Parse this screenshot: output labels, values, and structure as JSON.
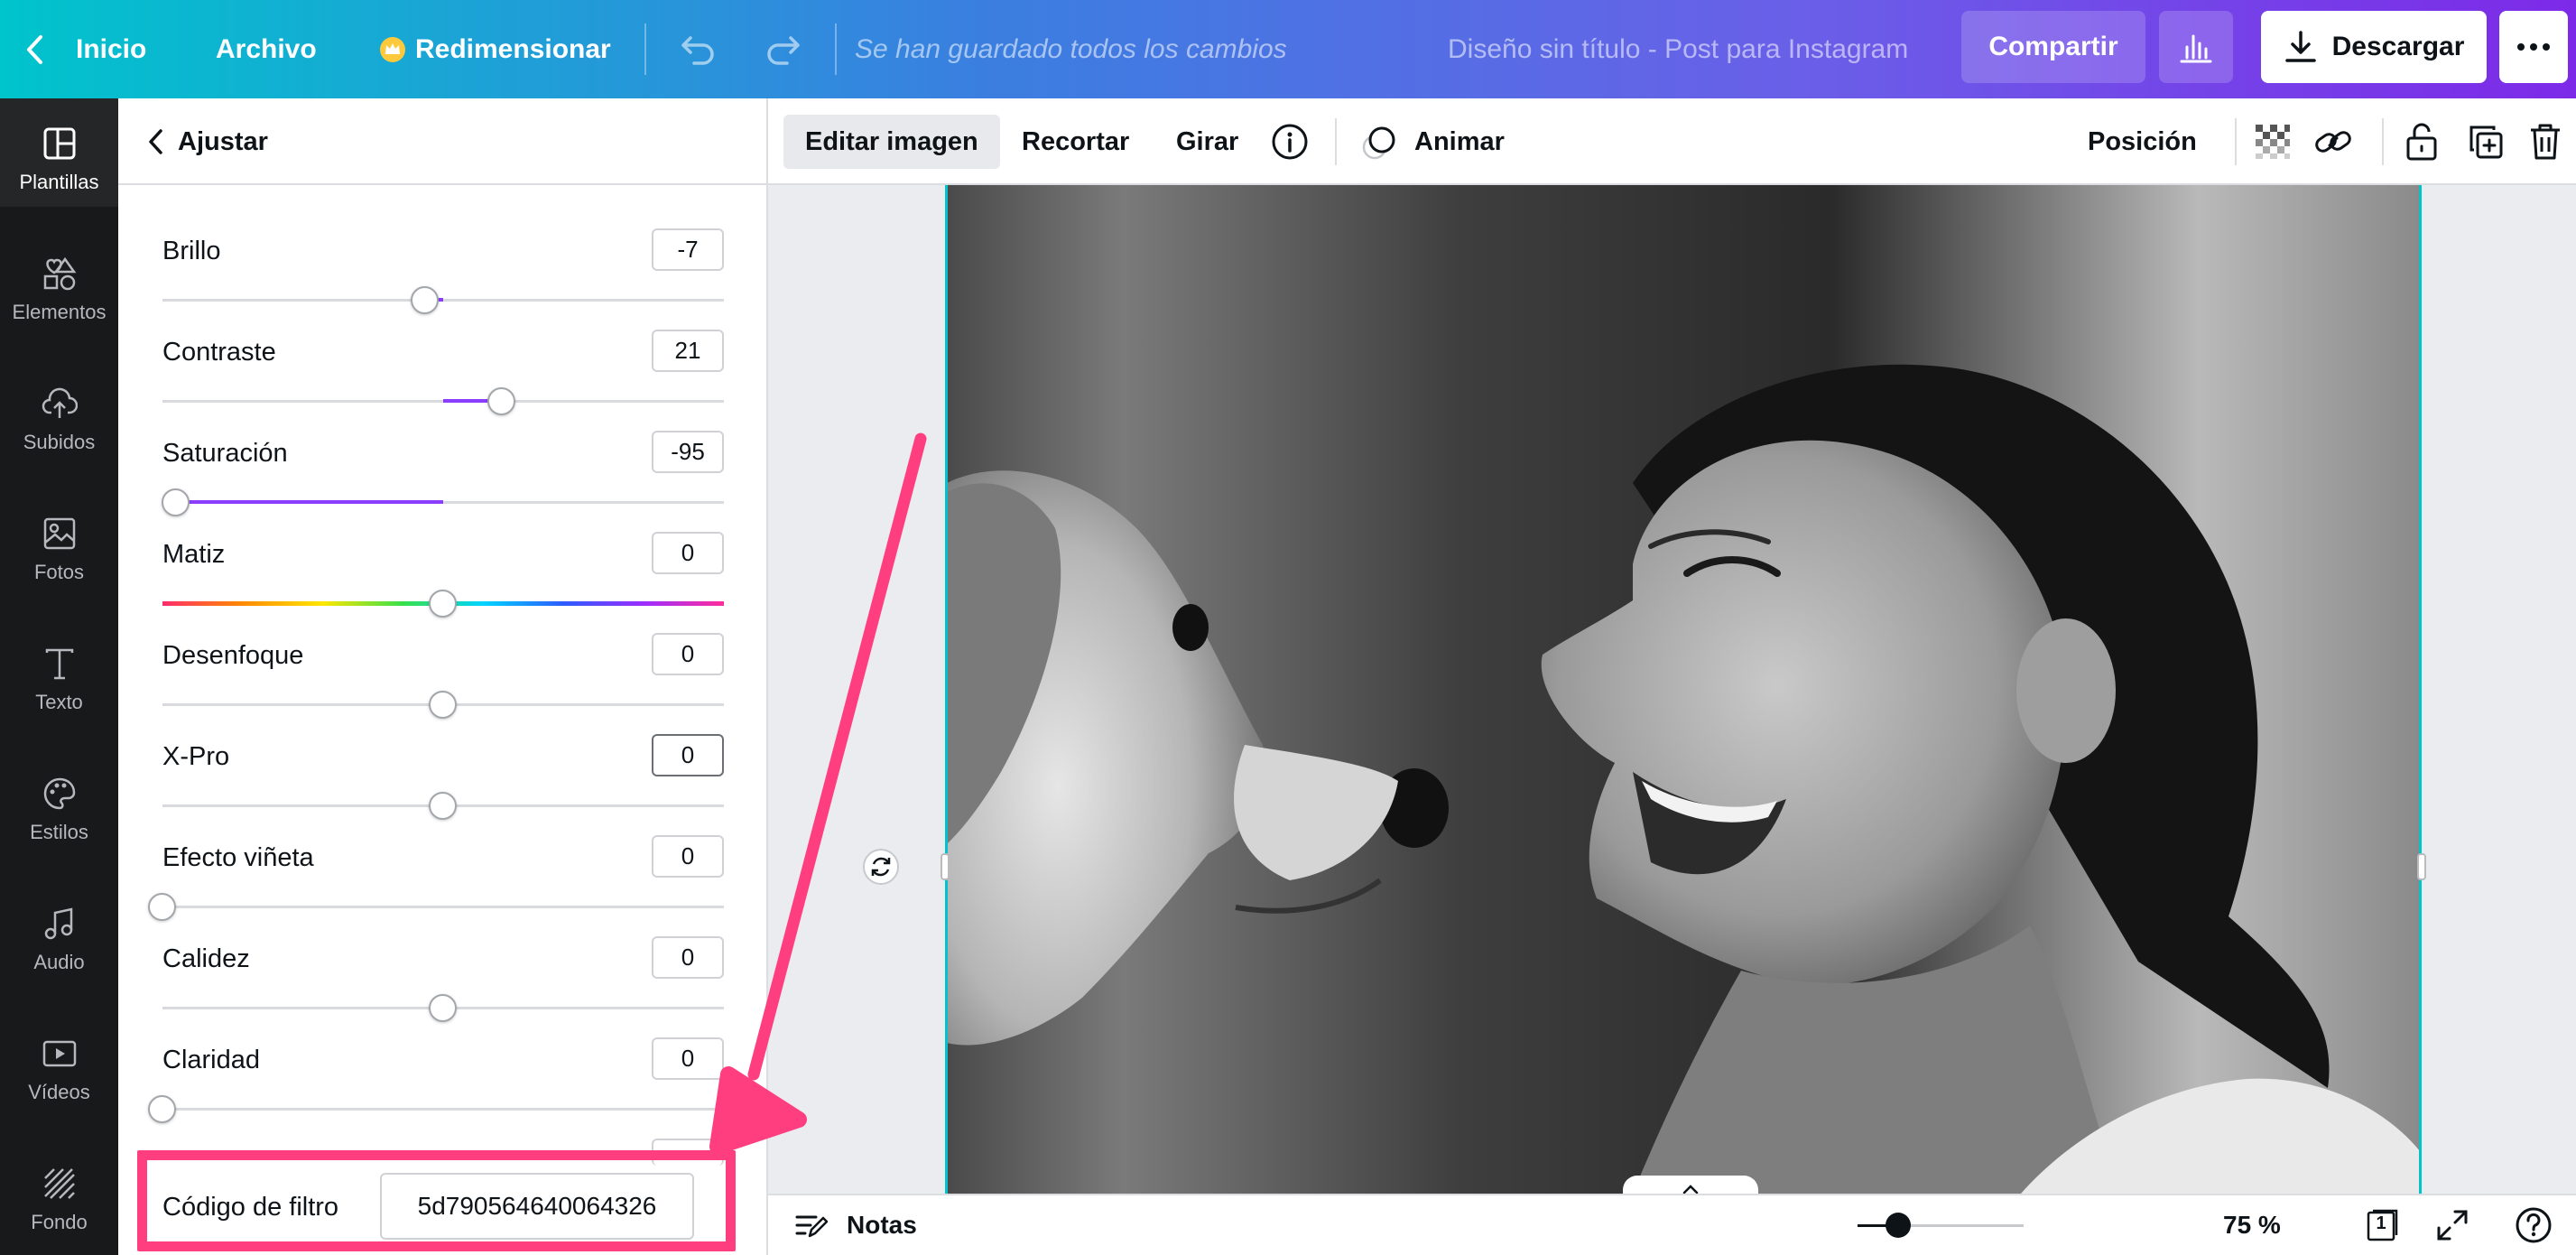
{
  "topbar": {
    "home": "Inicio",
    "file": "Archivo",
    "resize": "Redimensionar",
    "save_status": "Se han guardado todos los cambios",
    "doc_title": "Diseño sin título - Post para Instagram",
    "share": "Compartir",
    "download": "Descargar"
  },
  "rail": {
    "items": [
      {
        "label": "Plantillas",
        "icon": "templates-icon"
      },
      {
        "label": "Elementos",
        "icon": "elements-icon"
      },
      {
        "label": "Subidos",
        "icon": "upload-icon"
      },
      {
        "label": "Fotos",
        "icon": "photos-icon"
      },
      {
        "label": "Texto",
        "icon": "text-icon"
      },
      {
        "label": "Estilos",
        "icon": "palette-icon"
      },
      {
        "label": "Audio",
        "icon": "audio-icon"
      },
      {
        "label": "Vídeos",
        "icon": "video-icon"
      },
      {
        "label": "Fondo",
        "icon": "background-icon"
      }
    ]
  },
  "panel": {
    "back_label": "Ajustar",
    "adjustments": [
      {
        "label": "Brillo",
        "value": "-7"
      },
      {
        "label": "Contraste",
        "value": "21"
      },
      {
        "label": "Saturación",
        "value": "-95"
      },
      {
        "label": "Matiz",
        "value": "0"
      },
      {
        "label": "Desenfoque",
        "value": "0"
      },
      {
        "label": "X-Pro",
        "value": "0"
      },
      {
        "label": "Efecto viñeta",
        "value": "0"
      },
      {
        "label": "Calidez",
        "value": "0"
      },
      {
        "label": "Claridad",
        "value": "0"
      }
    ],
    "filter_code_label": "Código de filtro",
    "filter_code_value": "5d790564640064326"
  },
  "context_toolbar": {
    "edit_image": "Editar imagen",
    "crop": "Recortar",
    "rotate": "Girar",
    "animate": "Animar",
    "position": "Posición"
  },
  "bottom": {
    "notes": "Notas",
    "zoom": "75 %",
    "page_count": "1"
  },
  "colors": {
    "accent": "#8b3dff",
    "highlight": "#ff3e7f",
    "selection": "#00c4cc"
  }
}
